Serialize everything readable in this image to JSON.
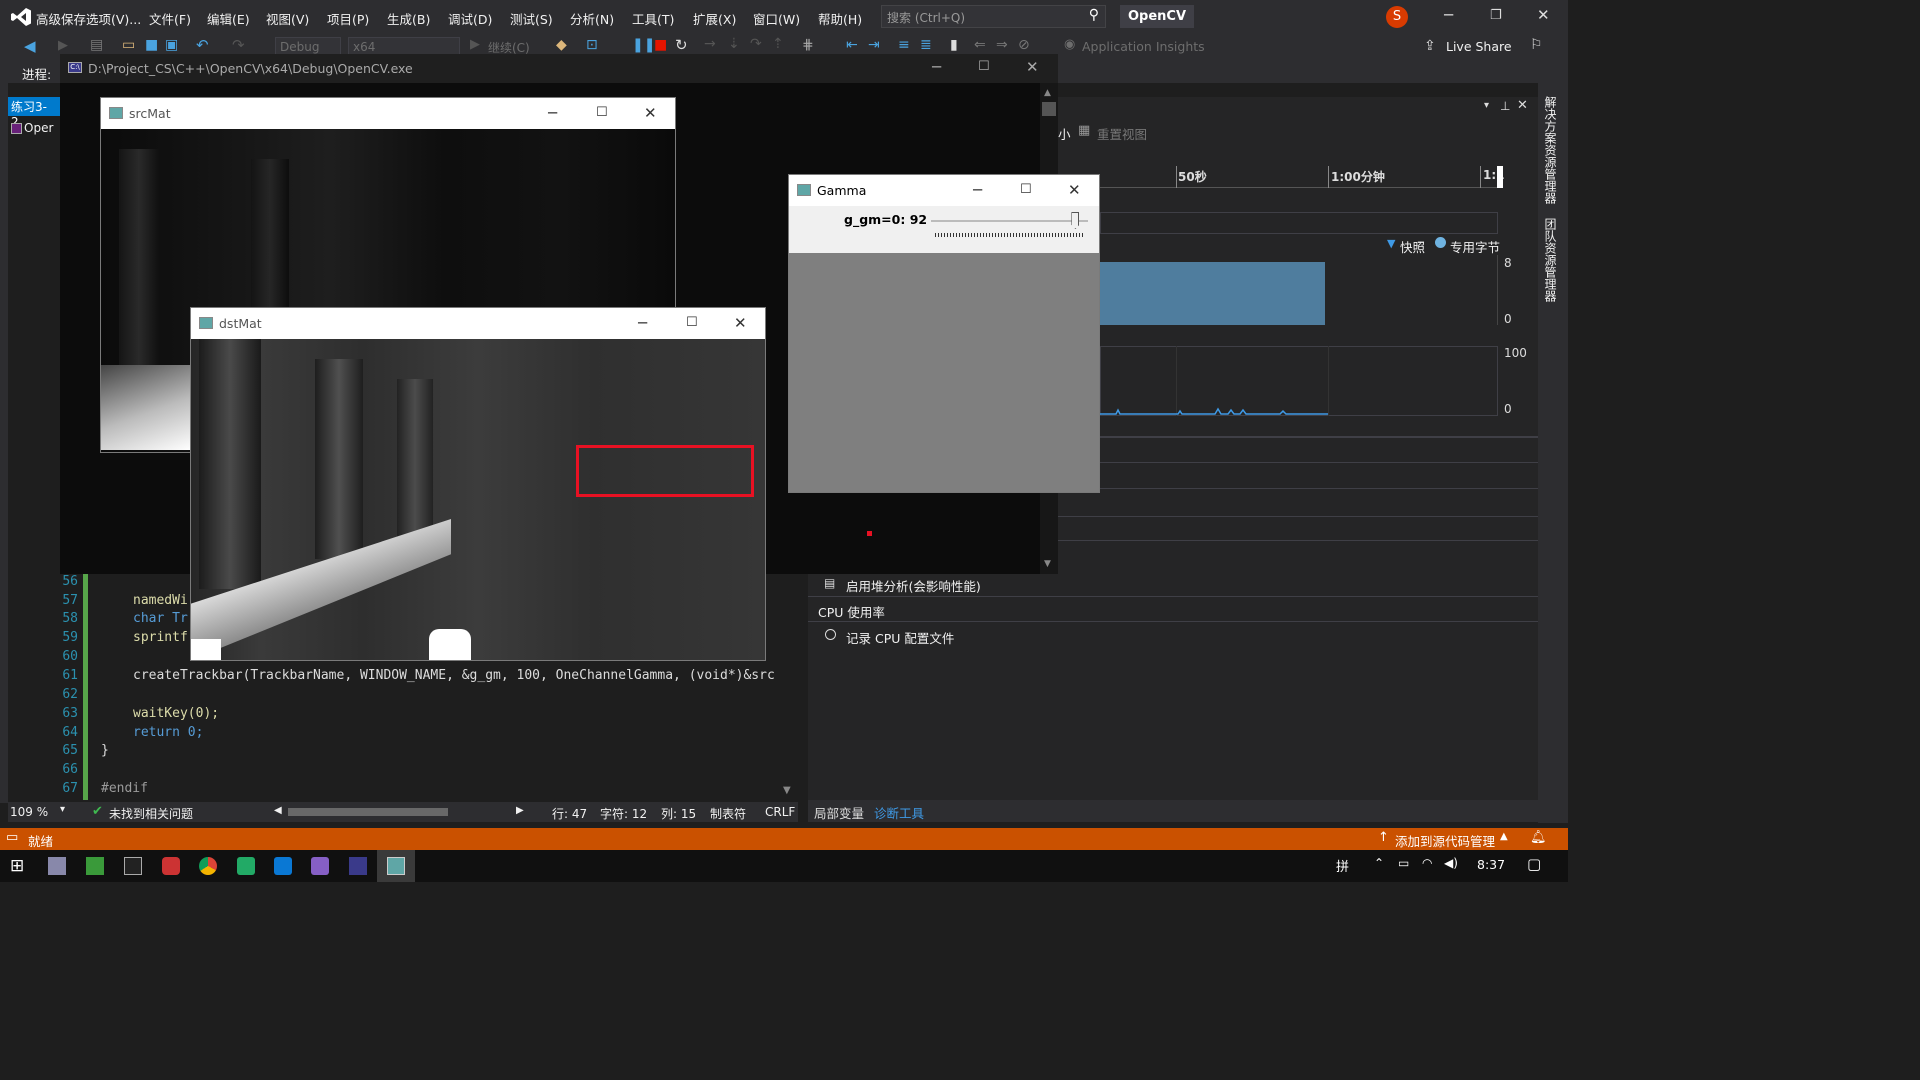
{
  "title_bar": {
    "menus": [
      "高级保存选项(V)...",
      "文件(F)",
      "编辑(E)",
      "视图(V)",
      "项目(P)",
      "生成(B)",
      "调试(D)",
      "测试(S)",
      "分析(N)",
      "工具(T)",
      "扩展(X)",
      "窗口(W)",
      "帮助(H)"
    ],
    "search_placeholder": "搜索 (Ctrl+Q)",
    "project_name": "OpenCV",
    "avatar_letter": "S"
  },
  "toolbar": {
    "config": "Debug",
    "platform": "x64",
    "continue_label": "继续(C)",
    "app_insights": "Application Insights",
    "live_share": "Live Share"
  },
  "process_bar": {
    "label": "进程:"
  },
  "doc_tab": {
    "label": "练习3-2."
  },
  "solution_item": {
    "label": "Oper"
  },
  "console": {
    "path": "D:\\Project_CS\\C++\\OpenCV\\x64\\Debug\\OpenCV.exe"
  },
  "src_window": {
    "title": "srcMat"
  },
  "dst_window": {
    "title": "dstMat"
  },
  "gamma_window": {
    "title": "Gamma",
    "trackbar_label": "g_gm=0: 92",
    "trackbar_value": 92,
    "trackbar_max": 100
  },
  "code_lines": [
    {
      "no": "56",
      "text": ""
    },
    {
      "no": "57",
      "text": "namedWi"
    },
    {
      "no": "58",
      "text": "char Tr"
    },
    {
      "no": "59",
      "text": "sprintf"
    },
    {
      "no": "60",
      "text": ""
    },
    {
      "no": "61",
      "text": "createTrackbar(TrackbarName, WINDOW_NAME, &g_gm, 100, OneChannelGamma, (void*)&src"
    },
    {
      "no": "62",
      "text": ""
    },
    {
      "no": "63",
      "text": "waitKey(0);"
    },
    {
      "no": "64",
      "text": "return 0;"
    },
    {
      "no": "65",
      "text": "}"
    },
    {
      "no": "66",
      "text": ""
    },
    {
      "no": "67",
      "text": "#endif"
    }
  ],
  "editor_status": {
    "zoom": "109 %",
    "issues": "未找到相关问题",
    "line": "行: 47",
    "char": "字符: 12",
    "col": "列: 15",
    "tabs": "制表符",
    "eol": "CRLF"
  },
  "diag": {
    "reset_view": "重置视图",
    "zoom_small": "小",
    "timeline": [
      "50秒",
      "1:00分钟",
      "1:1"
    ],
    "legend": [
      "快照",
      "专用字节"
    ],
    "mem_axis": [
      "8",
      "0"
    ],
    "cpu_axis": [
      "100",
      "0"
    ],
    "heap_option": "启用堆分析(会影响性能)",
    "cpu_section": "CPU 使用率",
    "cpu_record": "记录 CPU 配置文件",
    "tabs": [
      "局部变量",
      "诊断工具"
    ]
  },
  "right_rail": [
    "解决方案资源管理器",
    "团队资源管理器"
  ],
  "status_bar": {
    "ready": "就绪",
    "source_control": "添加到源代码管理"
  },
  "taskbar": {
    "time": "8:37",
    "ime": "拼"
  },
  "colors": {
    "accent": "#007acc",
    "status": "#ca5100",
    "highlight_box": "#e81123"
  }
}
